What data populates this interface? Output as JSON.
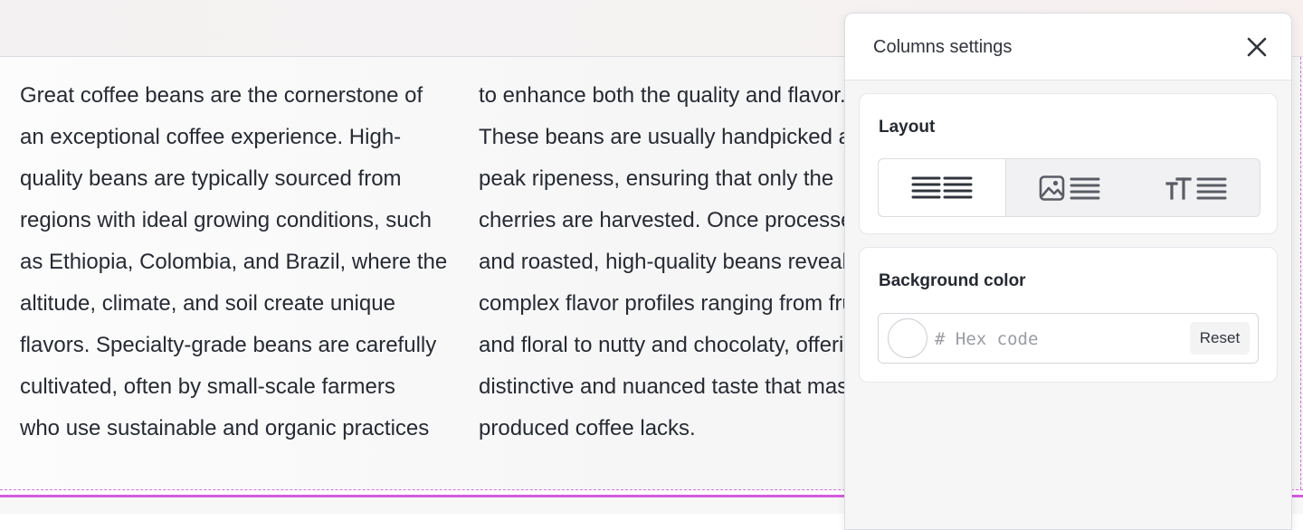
{
  "article": {
    "column_1_lines": [
      "Great coffee beans are the cornerstone of",
      "an exceptional coffee experience. High-",
      "quality beans are typically sourced from",
      "regions with ideal growing conditions, such",
      "as Ethiopia, Colombia, and Brazil, where the",
      "altitude, climate, and soil create unique",
      "flavors. Specialty-grade beans are carefully",
      "cultivated, often by small-scale farmers",
      "who use sustainable and organic practices"
    ],
    "column_2_lines": [
      "to enhance both the quality and flavor.",
      "These beans are usually handpicked at",
      "peak ripeness, ensuring that only the",
      "cherries are harvested. Once processed",
      "and roasted, high-quality beans reveal",
      "complex flavor profiles ranging from fruity",
      "and floral to nutty and chocolaty, offering a",
      "distinctive and nuanced taste that mass-",
      "produced coffee lacks."
    ]
  },
  "panel": {
    "title": "Columns settings",
    "close_icon": "close-icon",
    "layout": {
      "title": "Layout",
      "options": [
        {
          "icon": "two-text-columns-icon",
          "selected": true
        },
        {
          "icon": "image-and-text-icon",
          "selected": false
        },
        {
          "icon": "heading-and-text-icon",
          "selected": false
        }
      ]
    },
    "background": {
      "title": "Background color",
      "hex_value": "",
      "hex_placeholder": "# Hex code",
      "reset_label": "Reset"
    }
  },
  "colors": {
    "accent_guide": "#d45ce0",
    "text": "#262a33",
    "panel_background": "#f6f6f7"
  }
}
